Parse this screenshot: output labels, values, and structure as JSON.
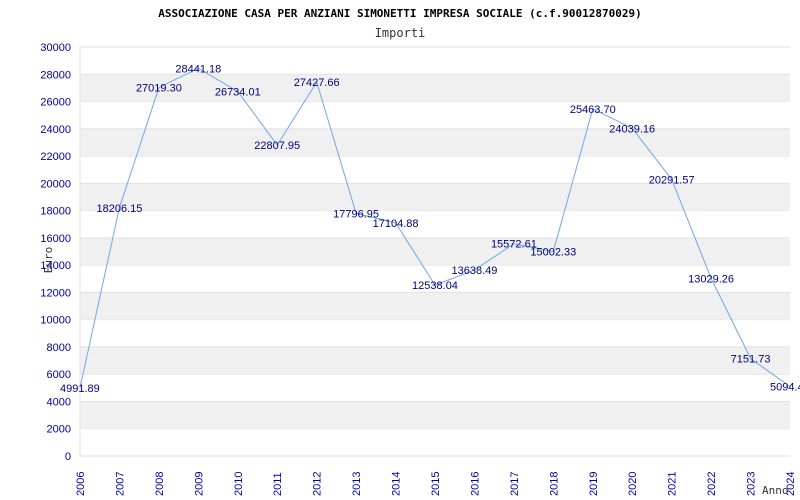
{
  "chart_data": {
    "type": "line",
    "title": "ASSOCIAZIONE CASA PER ANZIANI SIMONETTI IMPRESA SOCIALE (c.f.90012870029)",
    "subtitle": "Importi",
    "xlabel": "Anno",
    "ylabel": "Euro",
    "categories": [
      "2006",
      "2007",
      "2008",
      "2009",
      "2010",
      "2011",
      "2012",
      "2013",
      "2014",
      "2015",
      "2016",
      "2017",
      "2018",
      "2019",
      "2020",
      "2021",
      "2022",
      "2023",
      "2024"
    ],
    "series": [
      {
        "values": [
          4991.89,
          18206.15,
          27019.3,
          28441.18,
          26734.01,
          22807.95,
          27427.66,
          17796.95,
          17104.88,
          12538.04,
          13638.49,
          15572.61,
          15002.33,
          25463.7,
          24039.16,
          20291.57,
          13029.26,
          7151.73,
          5094.4
        ],
        "labels": [
          "4991.89",
          "18206.15",
          "27019.30",
          "28441.18",
          "26734.01",
          "22807.95",
          "27427.66",
          "17796.95",
          "17104.88",
          "12538.04",
          "13638.49",
          "15572.61",
          "15002.33",
          "25463.70",
          "24039.16",
          "20291.57",
          "13029.26",
          "7151.73",
          "5094.4"
        ]
      }
    ],
    "ylim": [
      0,
      30000
    ],
    "yticks": [
      "0",
      "2000",
      "4000",
      "6000",
      "8000",
      "10000",
      "12000",
      "14000",
      "16000",
      "18000",
      "20000",
      "22000",
      "24000",
      "26000",
      "28000",
      "30000"
    ],
    "grid": "horizontal alternating bands",
    "colors": {
      "line": "#6fa8e6",
      "band": "#f0f0f0",
      "tick_text": "#0000aa",
      "label_text": "#000080"
    }
  }
}
